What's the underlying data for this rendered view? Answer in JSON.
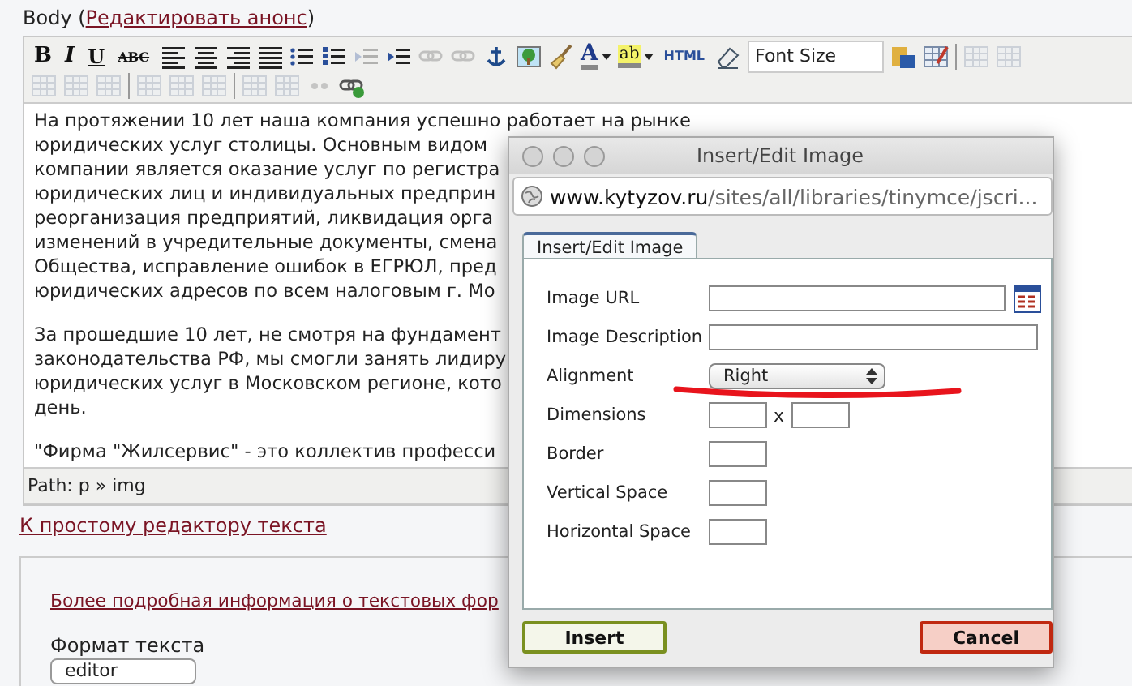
{
  "field_label": {
    "text": "Body (",
    "link": "Редактировать анонс",
    "close": ")"
  },
  "toolbar": {
    "rows": [
      [
        {
          "kind": "bold",
          "label": "B",
          "disabled": false
        },
        {
          "kind": "italic",
          "label": "I",
          "disabled": false
        },
        {
          "kind": "underline",
          "label": "U",
          "disabled": false
        },
        {
          "kind": "strike",
          "label": "ABC",
          "disabled": false
        },
        {
          "kind": "align-left",
          "disabled": false
        },
        {
          "kind": "align-center",
          "disabled": false
        },
        {
          "kind": "align-right",
          "disabled": false
        },
        {
          "kind": "justify",
          "disabled": false
        },
        {
          "kind": "bullets",
          "disabled": false
        },
        {
          "kind": "numbers",
          "disabled": false
        },
        {
          "kind": "outdent",
          "disabled": true
        },
        {
          "kind": "indent",
          "disabled": false
        },
        {
          "kind": "link",
          "disabled": true
        },
        {
          "kind": "unlink",
          "disabled": true
        },
        {
          "kind": "anchor",
          "disabled": false
        },
        {
          "kind": "image",
          "disabled": false
        },
        {
          "kind": "brush",
          "disabled": false
        },
        {
          "kind": "color",
          "label": "A",
          "disabled": false
        },
        {
          "kind": "highlight",
          "label": "ab",
          "disabled": false
        },
        {
          "kind": "html",
          "label": "HTML",
          "disabled": false
        },
        {
          "kind": "eraser",
          "disabled": false
        },
        {
          "kind": "select",
          "label": "Font Size",
          "disabled": false
        },
        {
          "kind": "paste",
          "disabled": false
        },
        {
          "kind": "table-edit",
          "disabled": false
        },
        {
          "kind": "sep",
          "disabled": false
        },
        {
          "kind": "table",
          "disabled": true
        },
        {
          "kind": "cells",
          "disabled": true
        }
      ],
      [
        {
          "kind": "row-before",
          "disabled": true
        },
        {
          "kind": "row-after",
          "disabled": true
        },
        {
          "kind": "row-delete",
          "disabled": true
        },
        {
          "kind": "sep",
          "disabled": false
        },
        {
          "kind": "col-before",
          "disabled": true
        },
        {
          "kind": "col-after",
          "disabled": true
        },
        {
          "kind": "col-delete",
          "disabled": true
        },
        {
          "kind": "sep",
          "disabled": false
        },
        {
          "kind": "table",
          "disabled": true
        },
        {
          "kind": "cells",
          "disabled": true
        },
        {
          "kind": "quote",
          "disabled": true
        },
        {
          "kind": "link-add",
          "disabled": false
        }
      ]
    ]
  },
  "content": {
    "paragraphs": [
      [
        "На протяжении 10 лет наша компания успешно работает на рынке",
        "юридических услуг столицы. Основным видом",
        "компании является оказание услуг по регистра",
        "юридических лиц и индивидуальных предприн",
        "реорганизация предприятий, ликвидация орга",
        "изменений в учредительные документы, смена",
        "Общества, исправление ошибок в ЕГРЮЛ, пред",
        "юридических адресов по всем налоговым г. Мо"
      ],
      [
        "За прошедшие 10 лет, не смотря на фундамент",
        "законодательства РФ, мы смогли занять лидиру",
        "юридических услуг в Московском регионе, кото",
        "день."
      ],
      [
        "\"Фирма \"Жилсервис\" - это коллектив професси"
      ]
    ]
  },
  "status_bar": "Path: p » img",
  "simple_editor_link": "К простому редактору текста",
  "formats": {
    "link": "Более подробная информация о текстовых фор",
    "label": "Формат текста",
    "value": "editor"
  },
  "dialog": {
    "title": "Insert/Edit Image",
    "url_host": "www.kytyzov.ru",
    "url_path": "/sites/all/libraries/tinymce/jscri...",
    "tabs": [
      {
        "label": "Insert/Edit Image",
        "selected": true
      }
    ],
    "fields": [
      {
        "kind": "browse",
        "label": "Image URL"
      },
      {
        "kind": "wide",
        "label": "Image Description"
      },
      {
        "kind": "select",
        "label": "Alignment",
        "value": "Right"
      },
      {
        "kind": "pair",
        "label": "Dimensions",
        "separator": "x"
      },
      {
        "kind": "small",
        "label": "Border"
      },
      {
        "kind": "small",
        "label": "Vertical Space"
      },
      {
        "kind": "small",
        "label": "Horizontal Space"
      }
    ],
    "buttons": [
      {
        "kind": "confirm",
        "label": "Insert"
      },
      {
        "kind": "cancel",
        "label": "Cancel"
      }
    ]
  }
}
